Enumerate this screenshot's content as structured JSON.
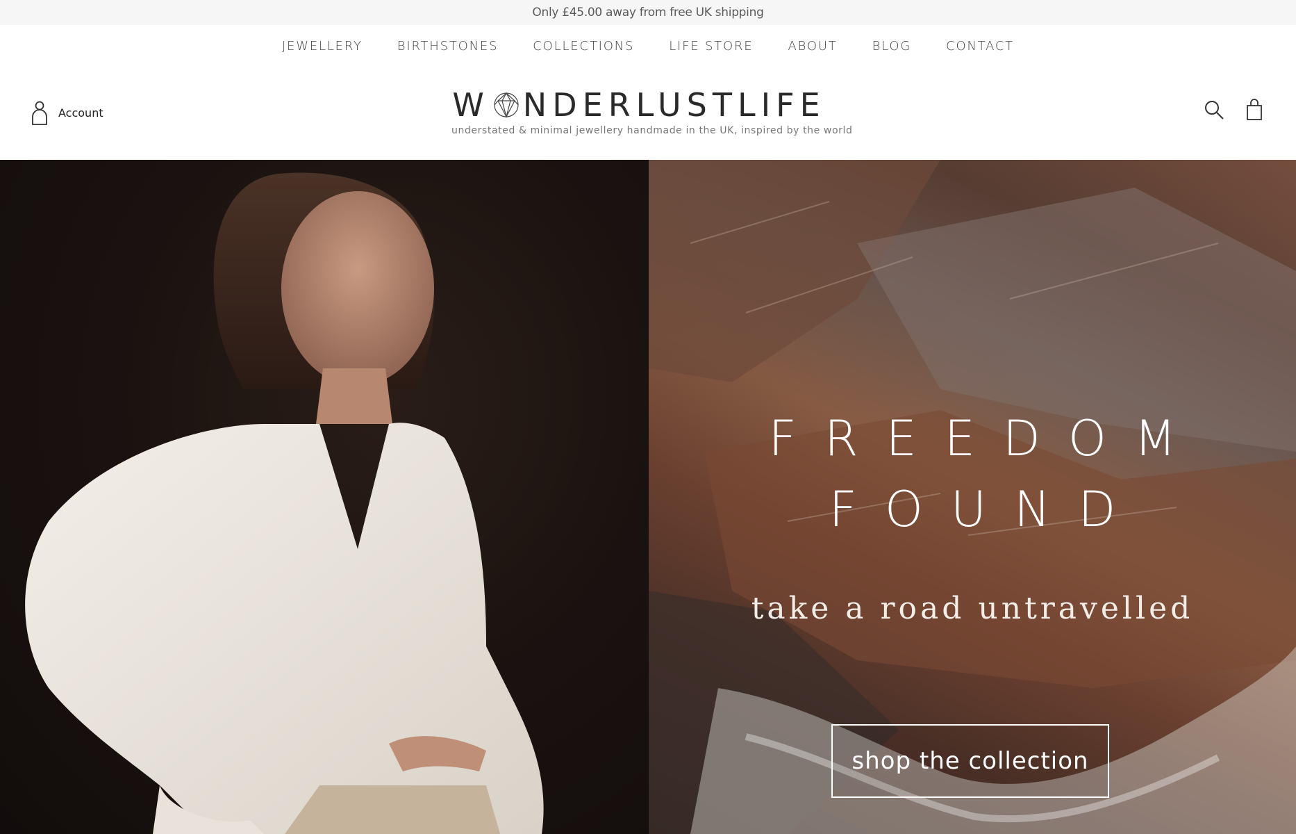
{
  "announcement": "Only £45.00 away from free UK shipping",
  "nav": [
    {
      "label": "JEWELLERY"
    },
    {
      "label": "BIRTHSTONES"
    },
    {
      "label": "COLLECTIONS"
    },
    {
      "label": "LIFE STORE"
    },
    {
      "label": "ABOUT"
    },
    {
      "label": "BLOG"
    },
    {
      "label": "CONTACT"
    }
  ],
  "header": {
    "account_label": "Account",
    "logo_pre": "W",
    "logo_post": "NDERLUSTLIFE",
    "tagline": "understated & minimal jewellery handmade in the UK, inspired by the world",
    "icons": [
      "user-icon",
      "gem-logo-icon",
      "search-icon",
      "bag-icon"
    ]
  },
  "hero": {
    "title_line1": "FREEDOM",
    "title_line2": "FOUND",
    "subtitle": "take a road untravelled",
    "cta": "shop the collection"
  },
  "colors": {
    "announcement_bg": "#f6f6f6",
    "text": "#444444",
    "hero_left_bg": "#1a1210",
    "hero_right_bg": "#6b4130",
    "cta_border": "#ffffff"
  }
}
